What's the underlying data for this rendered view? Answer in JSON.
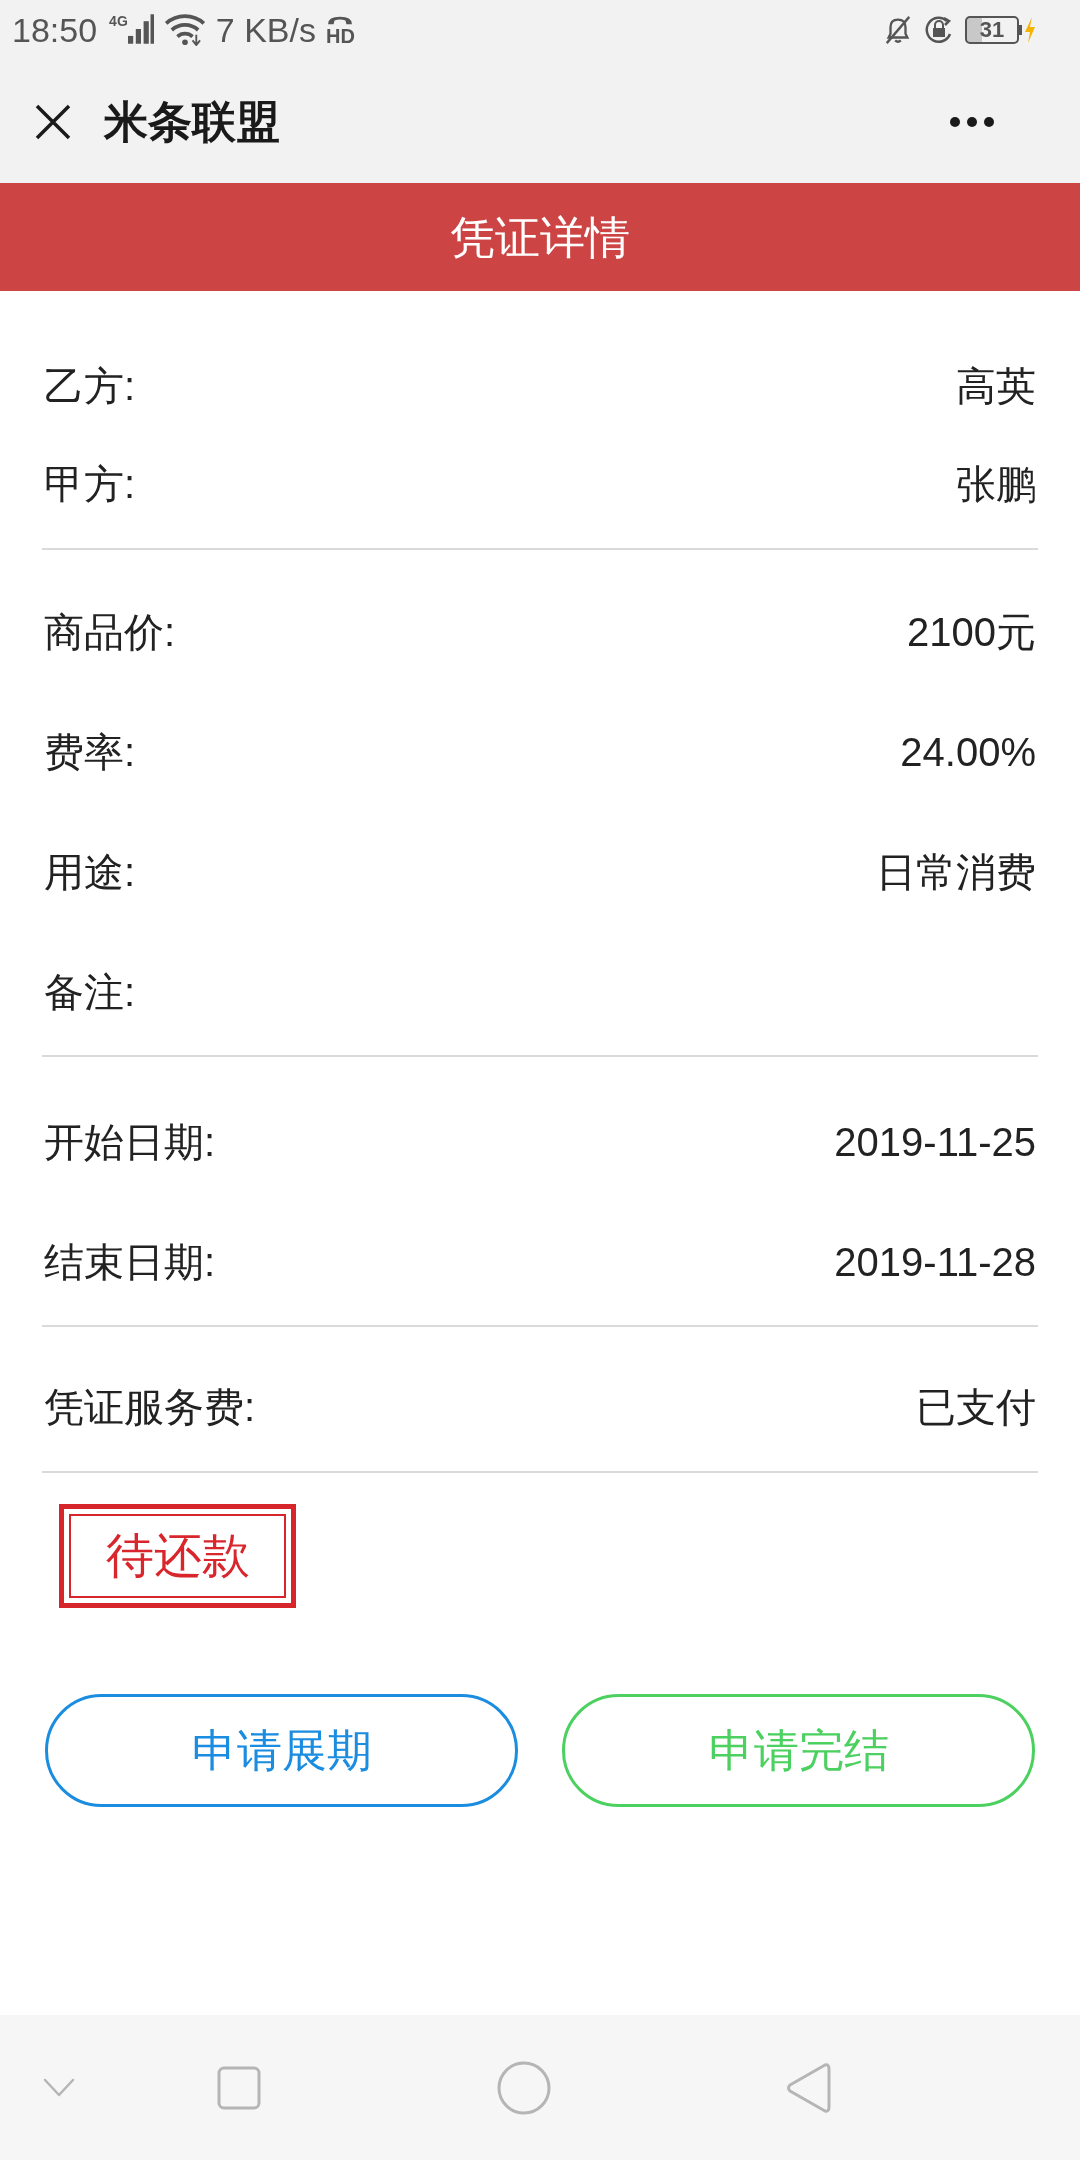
{
  "status_bar": {
    "time": "18:50",
    "network_type": "4G",
    "speed": "7 KB/s",
    "hd_label": "HD",
    "battery": "31",
    "charging": true
  },
  "toolbar": {
    "title": "米条联盟"
  },
  "banner": {
    "title": "凭证详情"
  },
  "sections": [
    {
      "rows": [
        {
          "label": "乙方:",
          "value": "高英"
        },
        {
          "label": "甲方:",
          "value": "张鹏"
        }
      ]
    },
    {
      "rows": [
        {
          "label": "商品价:",
          "value": "2100元"
        },
        {
          "label": "费率:",
          "value": "24.00%"
        },
        {
          "label": "用途:",
          "value": "日常消费"
        },
        {
          "label": "备注:"
        }
      ]
    },
    {
      "rows": [
        {
          "label": "开始日期:",
          "value": "2019-11-25"
        },
        {
          "label": "结束日期:",
          "value": "2019-11-28"
        }
      ]
    },
    {
      "rows": [
        {
          "label": "凭证服务费:",
          "value": "已支付"
        }
      ]
    }
  ],
  "stamp": {
    "text": "待还款"
  },
  "buttons": [
    {
      "label": "申请展期",
      "color": "#1b8de0"
    },
    {
      "label": "申请完结",
      "color": "#4cd160"
    }
  ]
}
